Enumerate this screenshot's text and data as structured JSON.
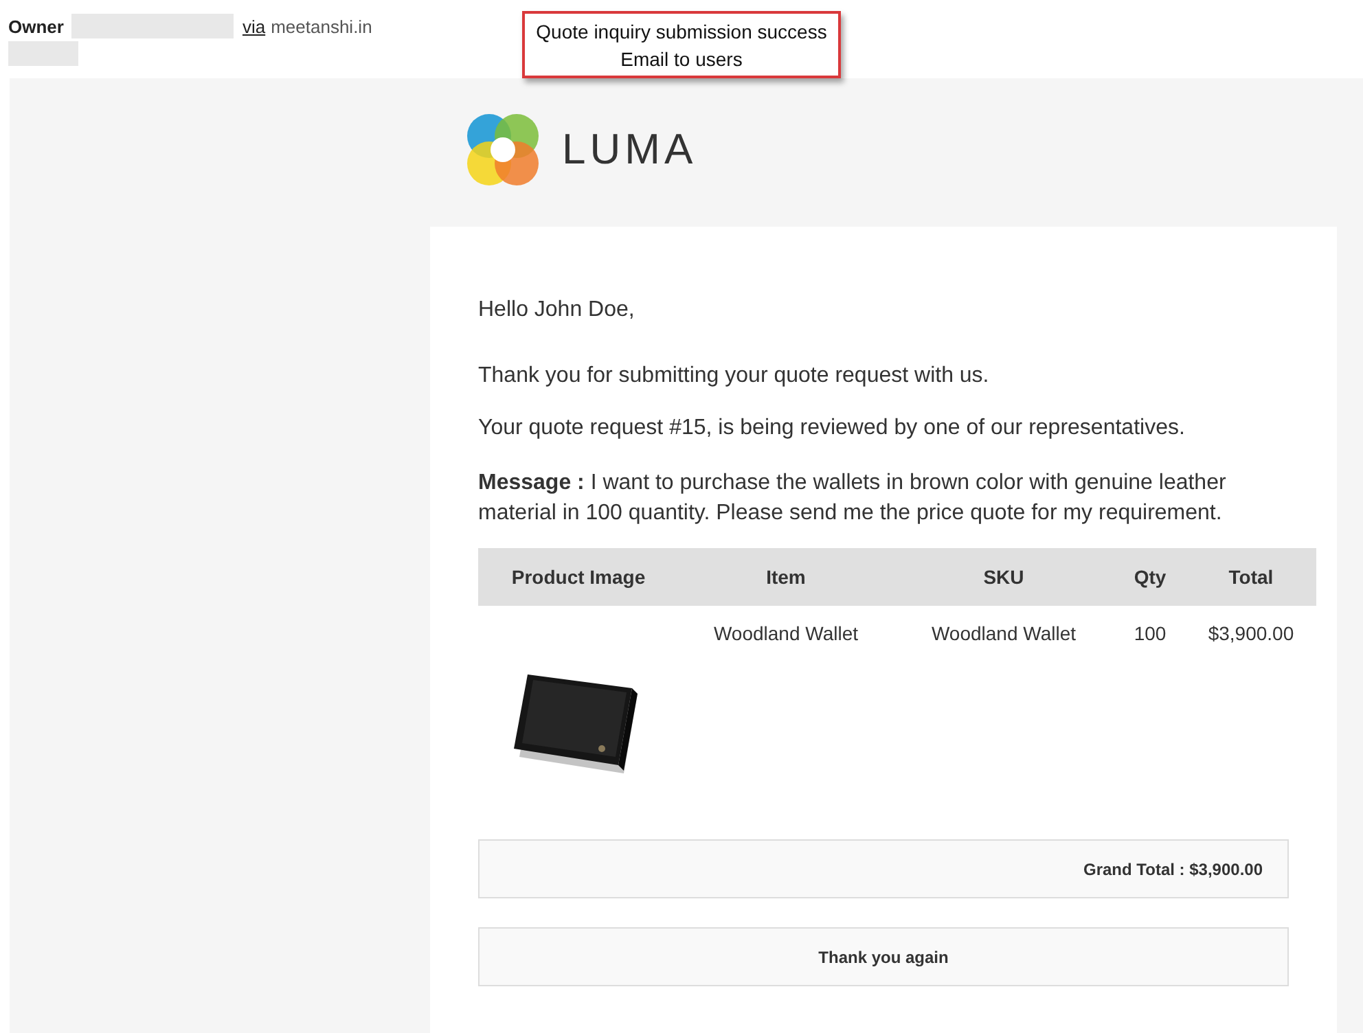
{
  "header": {
    "sender_label": "Owner",
    "via": "via",
    "domain": "meetanshi.in"
  },
  "callout": {
    "lines": [
      "Quote inquiry submission success",
      "Email to users"
    ]
  },
  "logo": {
    "name": "LUMA"
  },
  "email": {
    "greeting": "Hello John Doe,",
    "paragraphs": [
      "Thank you for submitting your quote request with us.",
      "Your quote request #15, is being reviewed by one of our representatives."
    ],
    "message": "**Message :** I want to purchase the wallets in brown color with genuine leather material in 100 quantity. Please send me the price quote for my requirement.",
    "table": {
      "columns": [
        "Product Image",
        "Item",
        "SKU",
        "Qty",
        "Total"
      ],
      "rows": [
        {
          "item": "Woodland Wallet",
          "sku": "Woodland Wallet",
          "qty": "100",
          "total": "$3,900.00"
        }
      ]
    },
    "grand_total": "Grand Total : $3,900.00",
    "closing": "Thank you again"
  }
}
